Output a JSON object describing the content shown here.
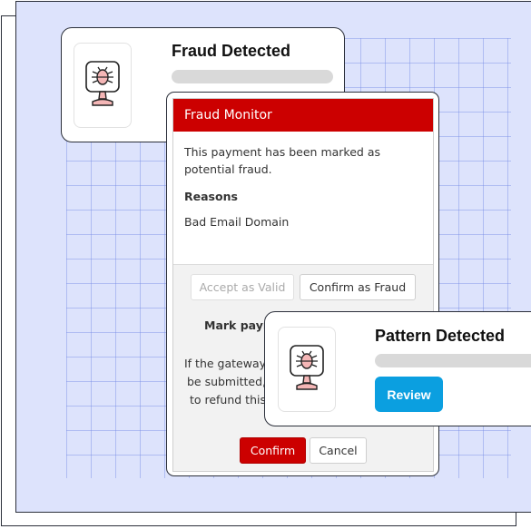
{
  "fraud_card": {
    "title": "Fraud Detected",
    "icon": "bug-monitor-icon"
  },
  "pattern_card": {
    "title": "Pattern Detected",
    "icon": "bug-monitor-icon",
    "review_label": "Review"
  },
  "dialog": {
    "title": "Fraud Monitor",
    "message": "This payment has been marked as potential fraud.",
    "reasons_label": "Reasons",
    "reason": "Bad Email Domain",
    "accept_label": "Accept as Valid",
    "confirm_fraud_label": "Confirm as Fraud",
    "mark_label": "Mark paym",
    "gateway_lines": [
      "If the gateway",
      "be submitted,",
      "to refund this"
    ],
    "confirm_label": "Confirm",
    "cancel_label": "Cancel"
  },
  "colors": {
    "background": "#dde3fc",
    "danger": "#cc0000",
    "accent": "#0b9fe0",
    "icon_fill": "#f4b6b6"
  }
}
